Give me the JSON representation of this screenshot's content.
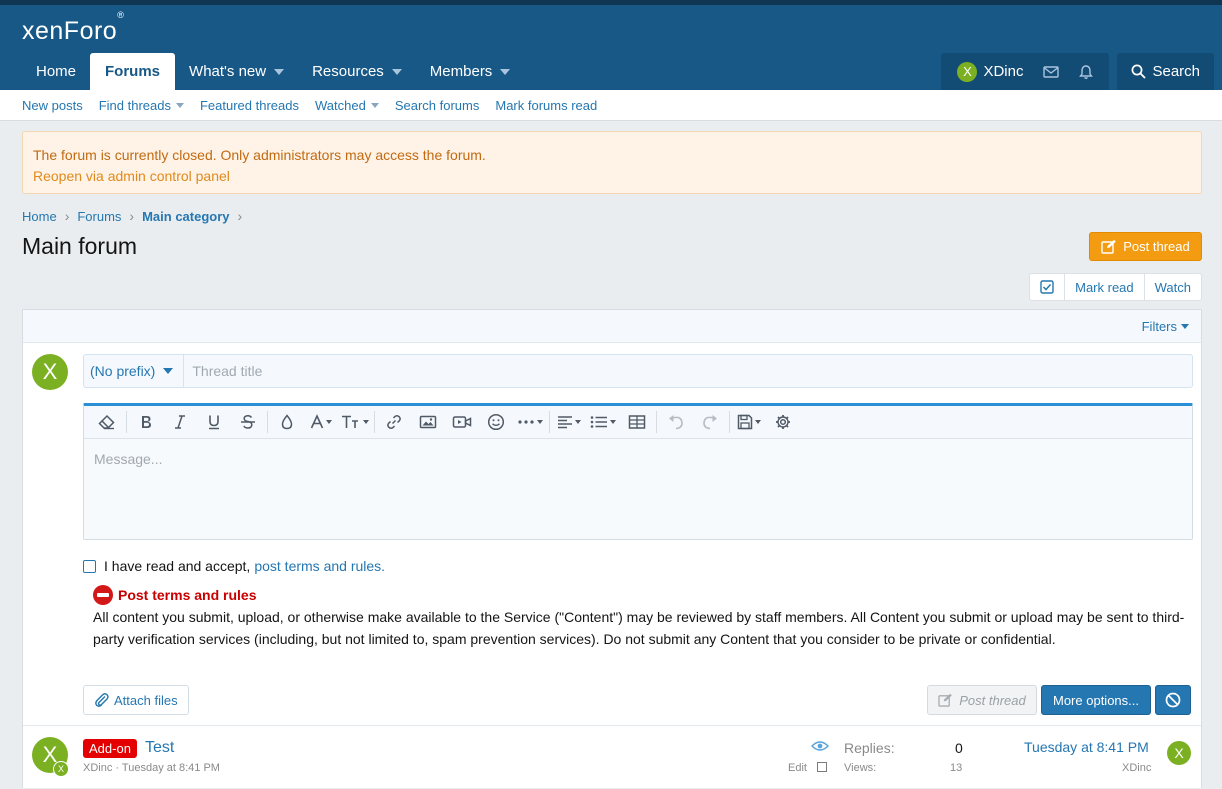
{
  "brand": {
    "logo_text": "xenForo",
    "logo_mark": "®"
  },
  "nav": {
    "home": "Home",
    "forums": "Forums",
    "whats_new": "What's new",
    "resources": "Resources",
    "members": "Members"
  },
  "user": {
    "name": "XDinc",
    "avatar_letter": "X"
  },
  "search": {
    "label": "Search"
  },
  "subnav": {
    "new_posts": "New posts",
    "find_threads": "Find threads",
    "featured_threads": "Featured threads",
    "watched": "Watched",
    "search_forums": "Search forums",
    "mark_forums_read": "Mark forums read"
  },
  "notice": {
    "text": "The forum is currently closed. Only administrators may access the forum.",
    "link": "Reopen via admin control panel"
  },
  "breadcrumb": {
    "home": "Home",
    "forums": "Forums",
    "category": "Main category",
    "sep": "›"
  },
  "page": {
    "title": "Main forum"
  },
  "actions": {
    "post_thread": "Post thread",
    "mark_read": "Mark read",
    "watch": "Watch"
  },
  "filters": {
    "label": "Filters"
  },
  "composer": {
    "prefix": "(No prefix)",
    "title_placeholder": "Thread title",
    "message_placeholder": "Message...",
    "accept_text": "I have read and accept,",
    "accept_link": "post terms and rules.",
    "terms_title": "Post terms and rules",
    "terms_body": "All content you submit, upload, or otherwise make available to the Service (\"Content\") may be reviewed by staff members. All Content you submit or upload may be sent to third-party verification services (including, but not limited to, spam prevention services). Do not submit any Content that you consider to be private or confidential.",
    "attach_files": "Attach files",
    "post_thread": "Post thread",
    "more_options": "More options..."
  },
  "thread": {
    "label": "Add-on",
    "title": "Test",
    "meta": "XDinc · Tuesday at 8:41 PM",
    "edit": "Edit",
    "replies_label": "Replies:",
    "replies": "0",
    "views_label": "Views:",
    "views": "13",
    "last_date": "Tuesday at 8:41 PM",
    "last_user": "XDinc",
    "avatar_letter": "X"
  },
  "colors": {
    "header": "#185886",
    "link": "#2577b1",
    "accent_orange": "#f39c12",
    "notice_bg": "#fef3e6",
    "label_red": "#e40000",
    "avatar_green": "#7bb022"
  },
  "icons": {
    "nav": [
      "inbox-icon",
      "bell-icon",
      "search-icon"
    ],
    "toolbar": [
      "eraser-icon",
      "bold-icon",
      "italic-icon",
      "underline-icon",
      "strikethrough-icon",
      "text-color-icon",
      "font-family-icon",
      "font-size-icon",
      "link-icon",
      "image-icon",
      "media-icon",
      "smilie-icon",
      "more-options-icon",
      "align-icon",
      "list-icon",
      "table-icon",
      "undo-icon",
      "redo-icon",
      "drafts-icon",
      "settings-icon"
    ]
  }
}
